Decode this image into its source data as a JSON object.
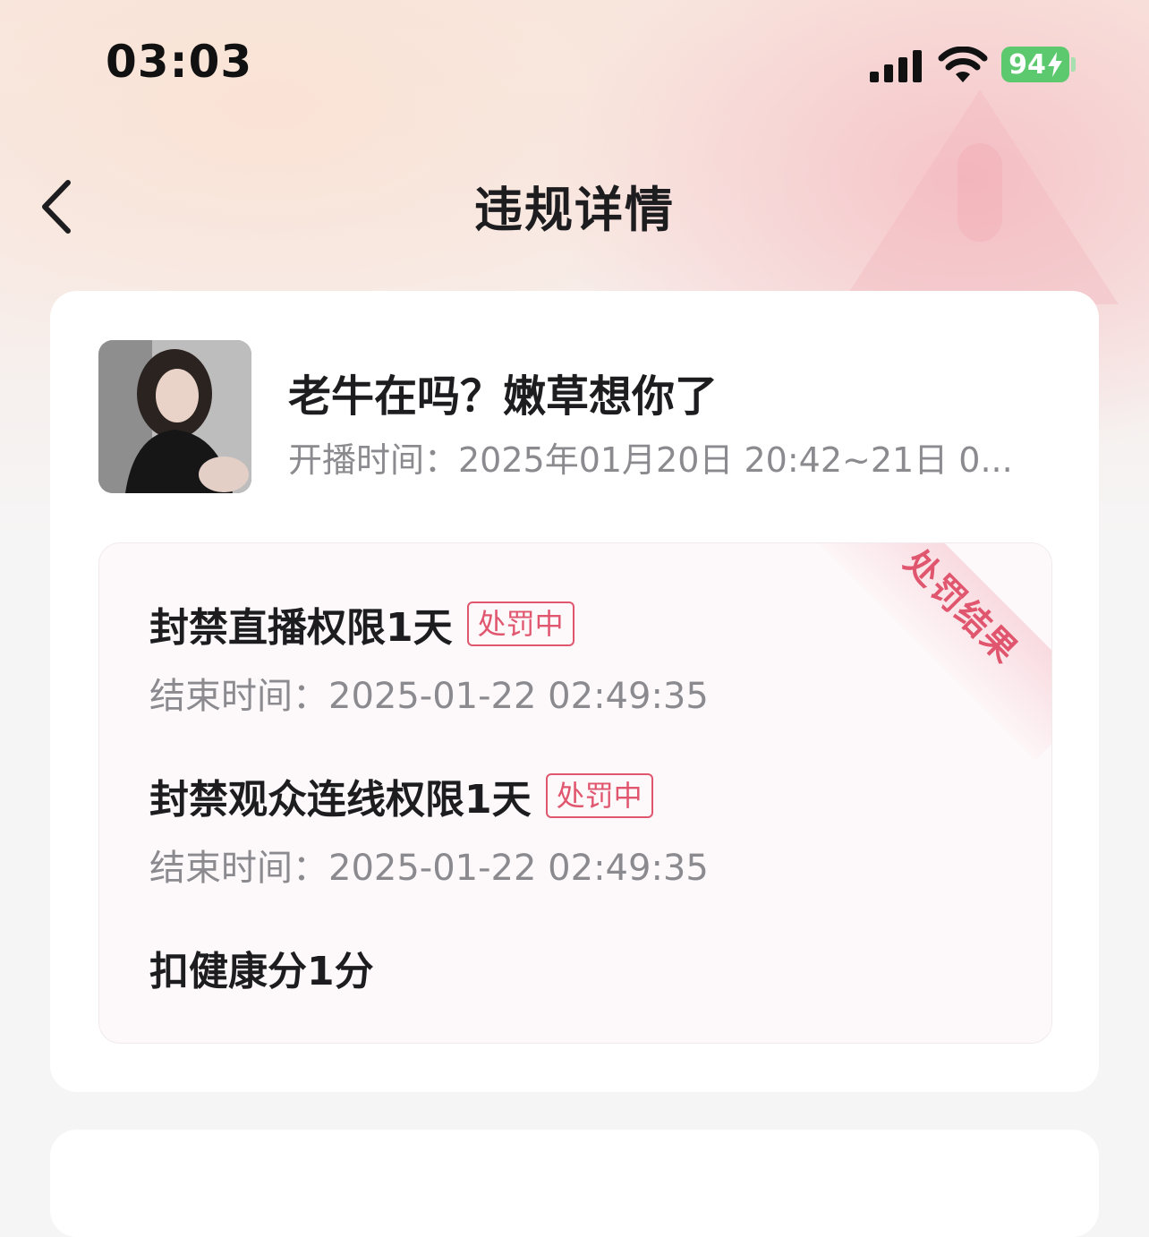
{
  "status_bar": {
    "time": "03:03",
    "battery": "94"
  },
  "nav": {
    "title": "违规详情"
  },
  "stream": {
    "title": "老牛在吗？嫩草想你了",
    "time_text": "开播时间：2025年01月20日 20:42~21日 0..."
  },
  "penalty": {
    "ribbon": "处罚结果",
    "items": [
      {
        "title": "封禁直播权限1天",
        "tag": "处罚中",
        "end_time": "结束时间：2025-01-22 02:49:35"
      },
      {
        "title": "封禁观众连线权限1天",
        "tag": "处罚中",
        "end_time": "结束时间：2025-01-22 02:49:35"
      },
      {
        "title": "扣健康分1分"
      }
    ]
  },
  "icons": {
    "back": "chevron-left-icon",
    "signal": "cellular-signal-icon",
    "wifi": "wifi-icon",
    "battery_bolt": "charging-bolt-icon"
  },
  "colors": {
    "accent": "#e0566e",
    "battery": "#5cc96e"
  }
}
